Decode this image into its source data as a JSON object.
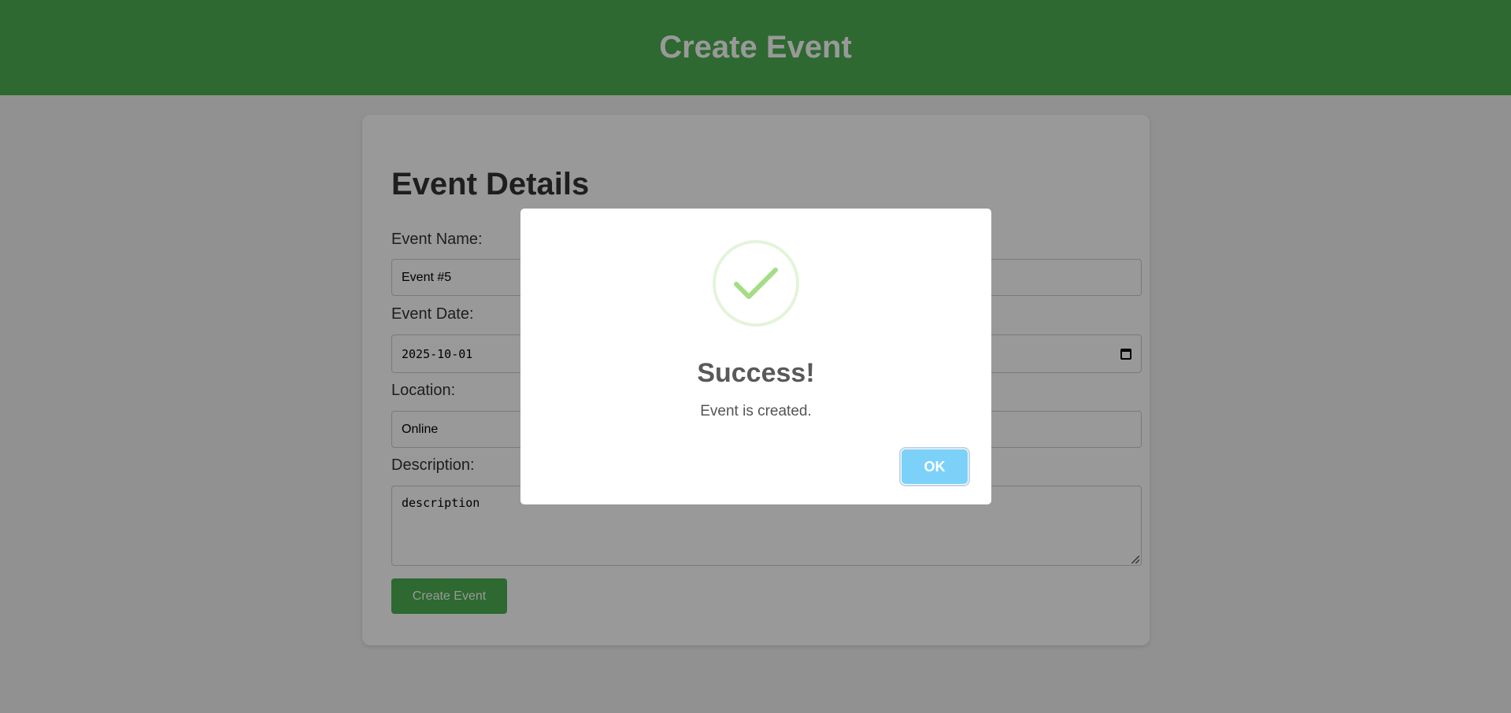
{
  "header": {
    "title": "Create Event"
  },
  "form": {
    "heading": "Event Details",
    "event_name": {
      "label": "Event Name:",
      "value": "Event #5"
    },
    "event_date": {
      "label": "Event Date:",
      "value": "2025-10-01"
    },
    "location": {
      "label": "Location:",
      "value": "Online"
    },
    "description": {
      "label": "Description:",
      "value": "description"
    },
    "submit_label": "Create Event"
  },
  "modal": {
    "icon": "success-check-icon",
    "title": "Success!",
    "text": "Event is created.",
    "ok_label": "OK"
  },
  "colors": {
    "header_bg": "#4caf50",
    "button_bg": "#4caf50",
    "ok_bg": "#7cd1f9",
    "check": "#a5dc86"
  }
}
